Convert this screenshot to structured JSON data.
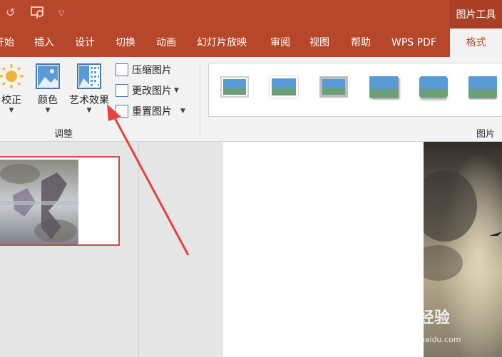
{
  "titlebar": {
    "contextual_group": "图片工具"
  },
  "tabs": [
    {
      "label": "开始"
    },
    {
      "label": "插入"
    },
    {
      "label": "设计"
    },
    {
      "label": "切换"
    },
    {
      "label": "动画"
    },
    {
      "label": "幻灯片放映"
    },
    {
      "label": "审阅"
    },
    {
      "label": "视图"
    },
    {
      "label": "帮助"
    },
    {
      "label": "WPS PDF"
    },
    {
      "label": "格式",
      "active": true
    }
  ],
  "ribbon": {
    "adjust": {
      "correct_label": "校正",
      "color_label": "颜色",
      "artistic_label": "艺术效果",
      "compress_label": "压缩图片",
      "change_label": "更改图片",
      "reset_label": "重置图片",
      "group_label": "调整"
    },
    "styles": {
      "group_label": "图片样"
    }
  },
  "watermark": {
    "brand": "Bai 经验",
    "url": "jingyan.baidu.com"
  },
  "colors": {
    "accent": "#b7472a",
    "ribbon_bg": "#f3f3f3",
    "selection_border": "#c0504d",
    "arrow": "#e8413c"
  },
  "icons": {
    "undo": "undo-icon",
    "present": "present-from-start-icon",
    "customize": "customize-qat-icon"
  }
}
